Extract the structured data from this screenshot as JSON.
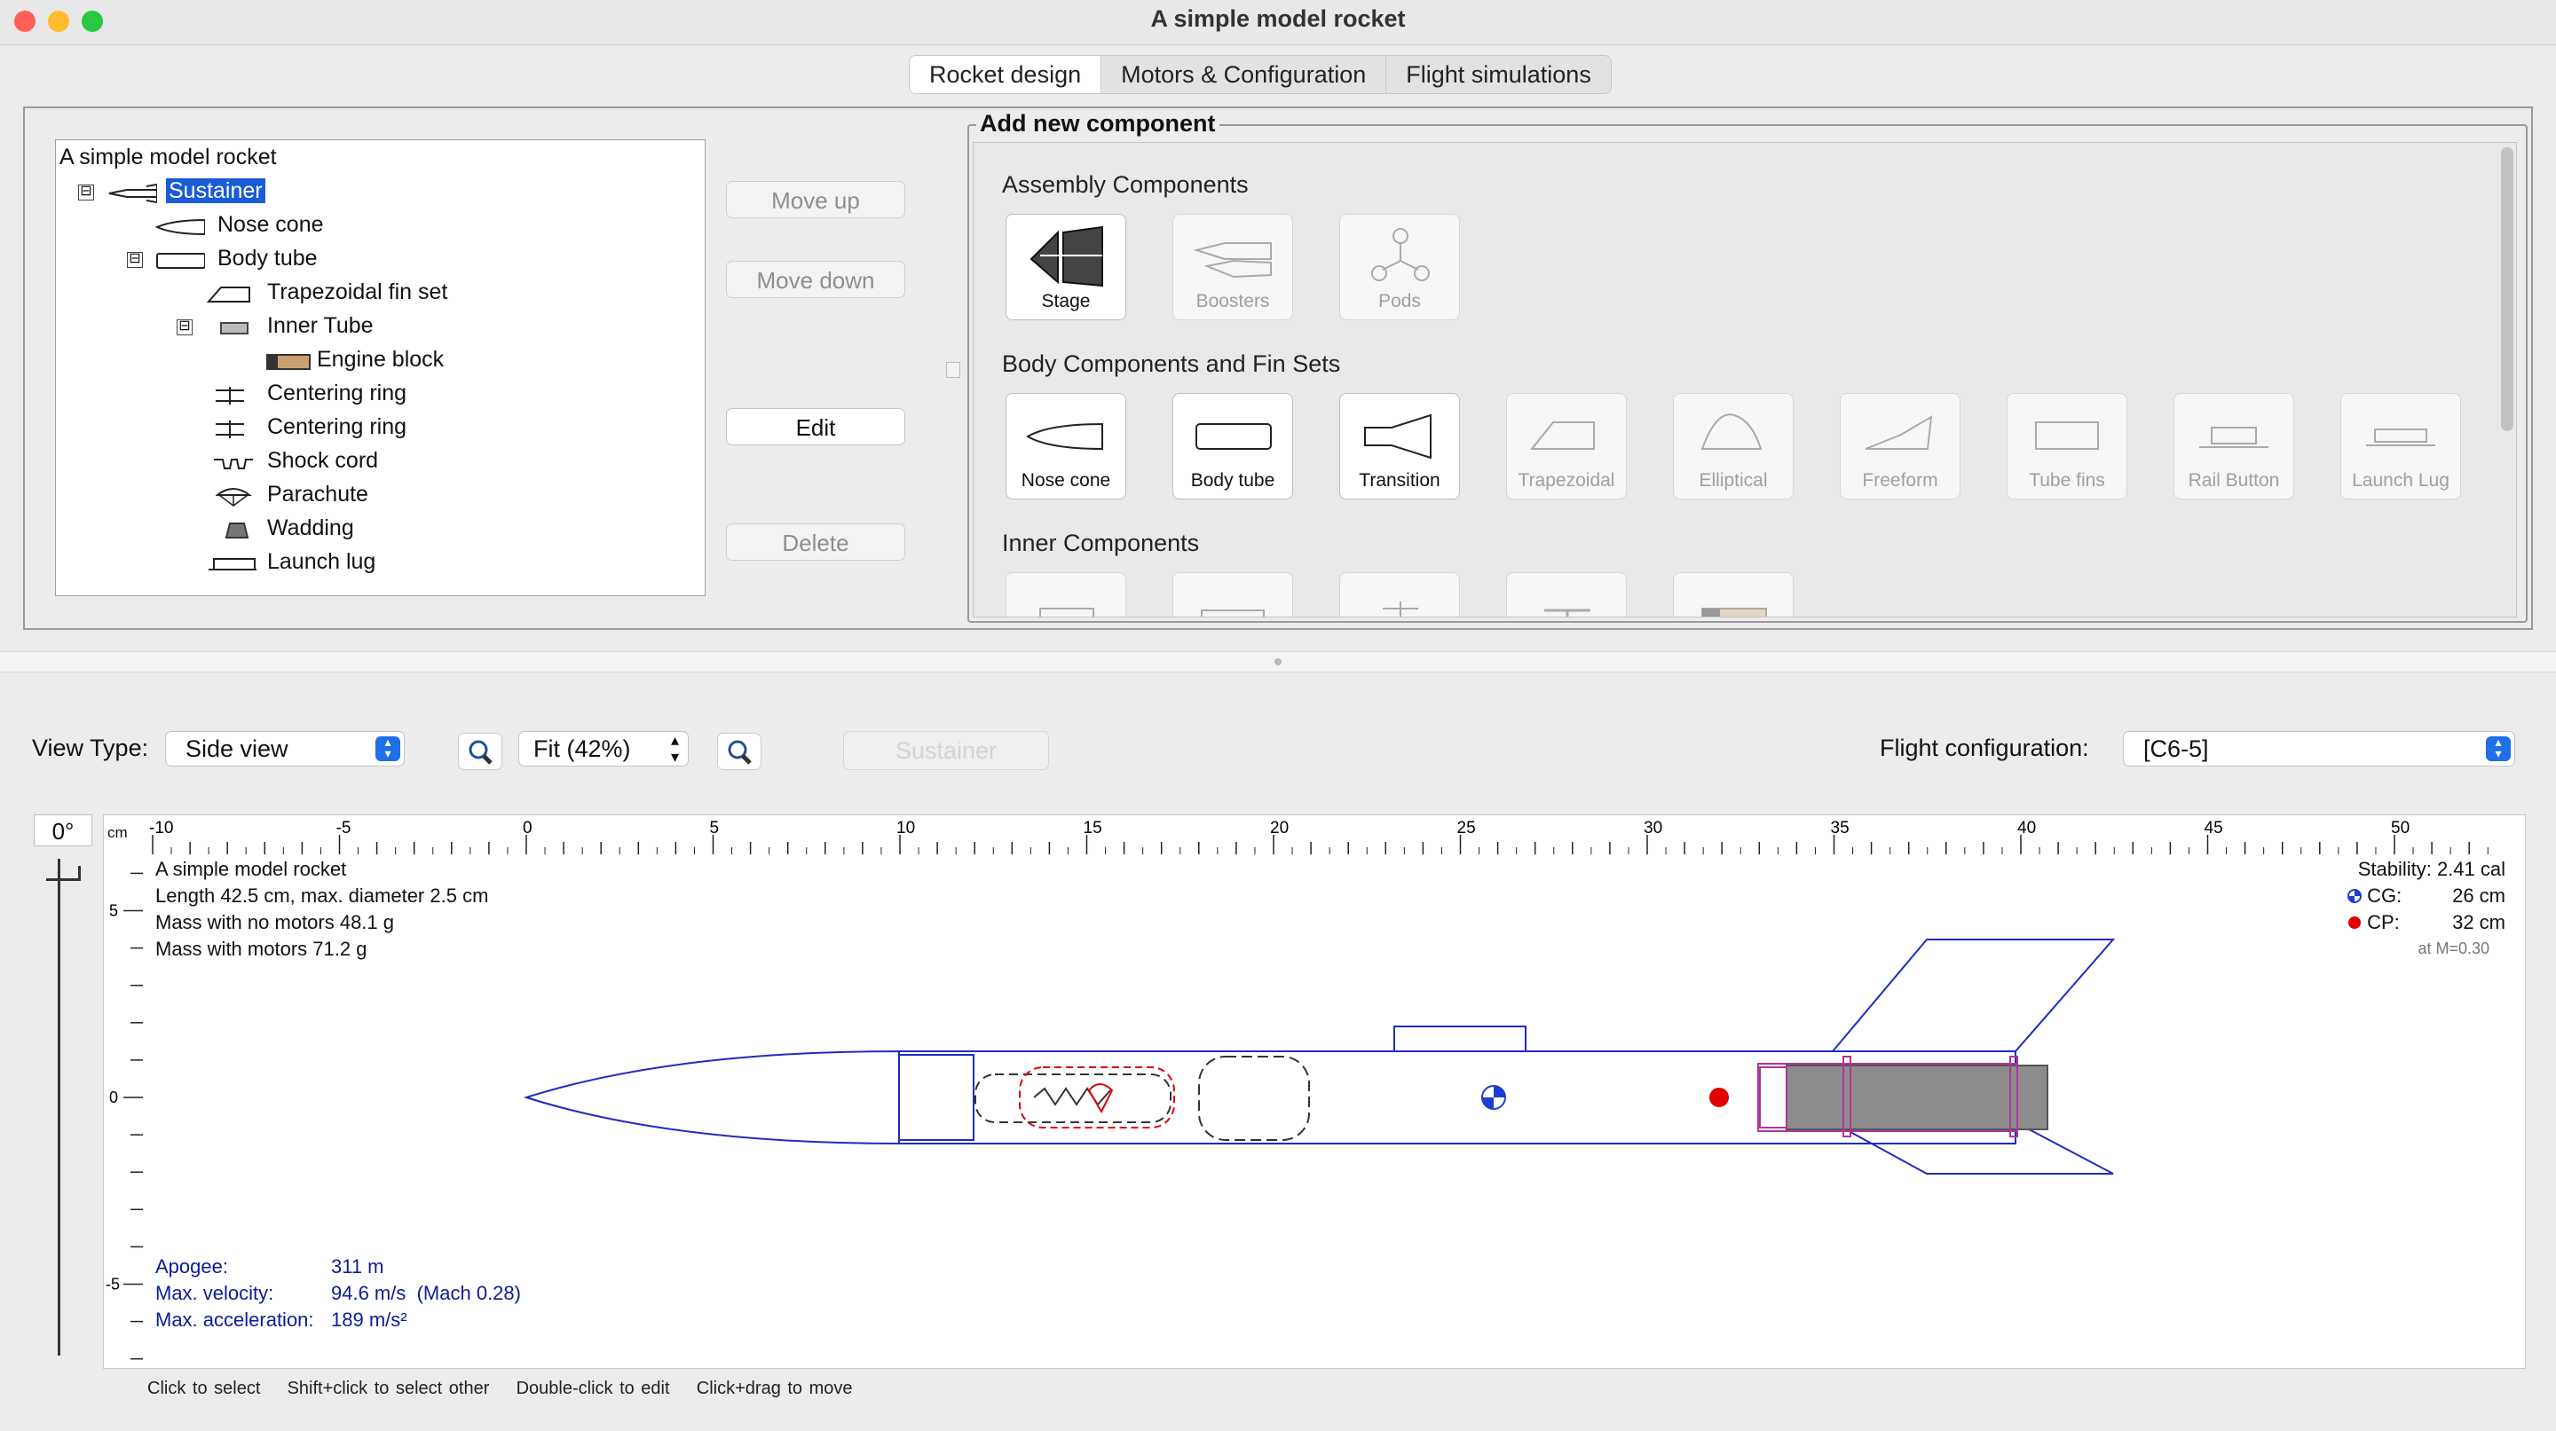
{
  "window": {
    "title": "A simple model rocket"
  },
  "tabs": [
    {
      "label": "Rocket design",
      "active": true
    },
    {
      "label": "Motors & Configuration",
      "active": false
    },
    {
      "label": "Flight simulations",
      "active": false
    }
  ],
  "tree": {
    "root": "A simple model rocket",
    "items": [
      {
        "label": "Sustainer",
        "selected": true,
        "toggle": "⊟",
        "icon": "sustainer-icon"
      },
      {
        "label": "Nose cone",
        "icon": "nose-cone-icon"
      },
      {
        "label": "Body tube",
        "toggle": "⊟",
        "icon": "body-tube-icon"
      },
      {
        "label": "Trapezoidal fin set",
        "icon": "trapezoidal-fin-icon"
      },
      {
        "label": "Inner Tube",
        "toggle": "⊟",
        "icon": "inner-tube-icon"
      },
      {
        "label": "Engine block",
        "icon": "engine-block-icon"
      },
      {
        "label": "Centering ring",
        "icon": "centering-ring-icon"
      },
      {
        "label": "Centering ring",
        "icon": "centering-ring-icon"
      },
      {
        "label": "Shock cord",
        "icon": "shock-cord-icon"
      },
      {
        "label": "Parachute",
        "icon": "parachute-icon"
      },
      {
        "label": "Wadding",
        "icon": "wadding-icon"
      },
      {
        "label": "Launch lug",
        "icon": "launch-lug-icon"
      }
    ]
  },
  "side_buttons": {
    "move_up": "Move up",
    "move_down": "Move down",
    "edit": "Edit",
    "delete": "Delete"
  },
  "add_component": {
    "title": "Add new component",
    "groups": {
      "assembly": "Assembly Components",
      "body": "Body Components and Fin Sets",
      "inner": "Inner Components"
    },
    "assembly": [
      {
        "label": "Stage",
        "enabled": true
      },
      {
        "label": "Boosters",
        "enabled": false
      },
      {
        "label": "Pods",
        "enabled": false
      }
    ],
    "body": [
      {
        "label": "Nose cone",
        "enabled": true
      },
      {
        "label": "Body tube",
        "enabled": true
      },
      {
        "label": "Transition",
        "enabled": true
      },
      {
        "label": "Trapezoidal",
        "enabled": false
      },
      {
        "label": "Elliptical",
        "enabled": false
      },
      {
        "label": "Freeform",
        "enabled": false
      },
      {
        "label": "Tube fins",
        "enabled": false
      },
      {
        "label": "Rail Button",
        "enabled": false
      },
      {
        "label": "Launch Lug",
        "enabled": false
      }
    ]
  },
  "view": {
    "view_type_label": "View Type:",
    "view_type": "Side view",
    "zoom": "Fit (42%)",
    "stage_button": "Sustainer",
    "flight_config_label": "Flight configuration:",
    "flight_config": "[C6-5]",
    "angle": "0°"
  },
  "figure": {
    "unit": "cm",
    "ruler_ticks": [
      "-10",
      "-5",
      "0",
      "5",
      "10",
      "15",
      "20",
      "25",
      "30",
      "35",
      "40",
      "45",
      "50"
    ],
    "vruler_ticks": [
      "5",
      "0",
      "-5"
    ],
    "name": "A simple model rocket",
    "length_line": "Length 42.5 cm, max. diameter 2.5 cm",
    "mass_no_motors": "Mass with no motors 48.1 g",
    "mass_with_motors": "Mass with motors 71.2 g",
    "stability": "Stability: 2.41 cal",
    "cg_label": "CG:",
    "cg_value": "26 cm",
    "cp_label": "CP:",
    "cp_value": "32 cm",
    "mach_note": "at M=0.30",
    "apogee_label": "Apogee:",
    "apogee_value": "311 m",
    "velocity_label": "Max. velocity:",
    "velocity_value": "94.6 m/s  (Mach 0.28)",
    "accel_label": "Max. acceleration:",
    "accel_value": "189 m/s²"
  },
  "hints": "Click to select    Shift+click to select other    Double-click to edit    Click+drag to move",
  "colors": {
    "selection": "#1a5cd7",
    "outline": "#1f2bc4",
    "cp": "#e00000",
    "cg": "#1b3fd0",
    "motor": "#8c8c8c"
  }
}
